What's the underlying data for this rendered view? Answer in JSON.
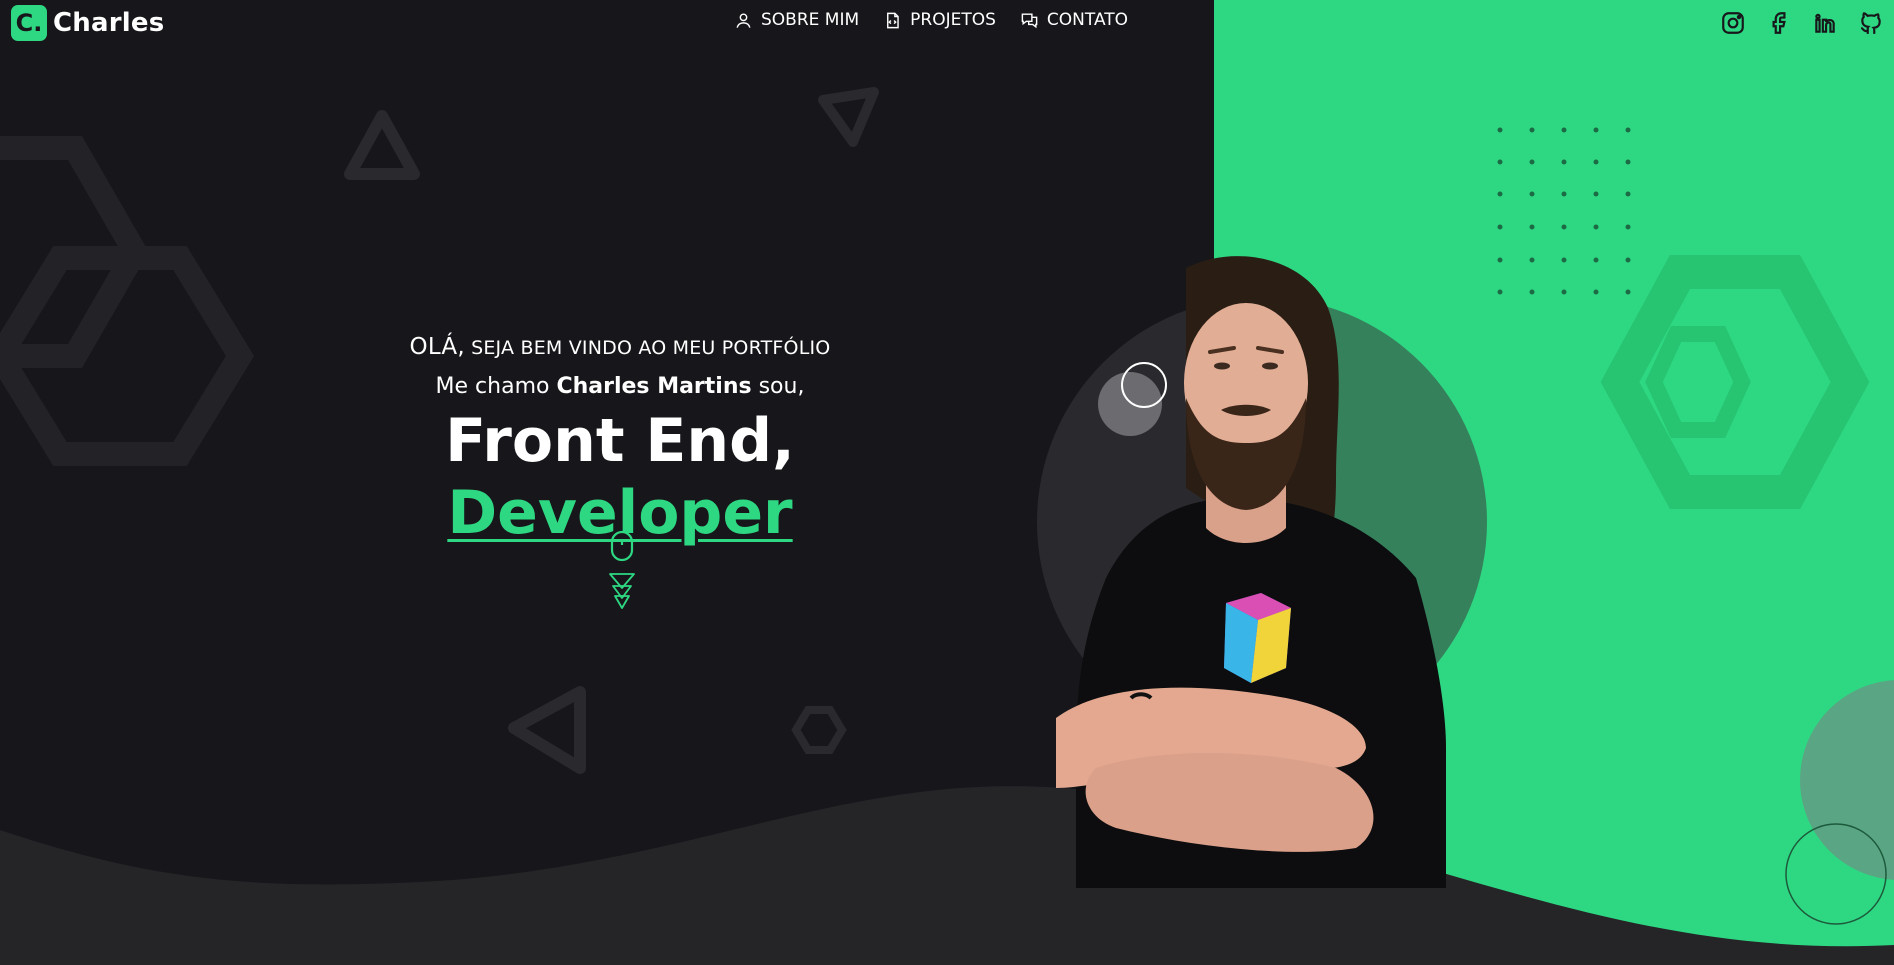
{
  "header": {
    "logo_mark": "C.",
    "logo_text": "Charles",
    "nav": [
      {
        "label": "SOBRE MIM",
        "icon": "user-icon"
      },
      {
        "label": "PROJETOS",
        "icon": "file-code-icon"
      },
      {
        "label": "CONTATO",
        "icon": "chat-icon"
      }
    ],
    "social": [
      "instagram-icon",
      "facebook-icon",
      "linkedin-icon",
      "github-icon"
    ]
  },
  "hero": {
    "greet_big": "OLÁ,",
    "greet_rest": "SEJA BEM VINDO AO MEU PORTFÓLIO",
    "intro_pre": "Me chamo",
    "intro_name": "Charles Martins",
    "intro_post": "sou,",
    "headline_plain": "Front End,",
    "headline_accent": "Developer"
  },
  "colors": {
    "background": "#17171b",
    "accent": "#2ed882",
    "wave": "#252528"
  }
}
